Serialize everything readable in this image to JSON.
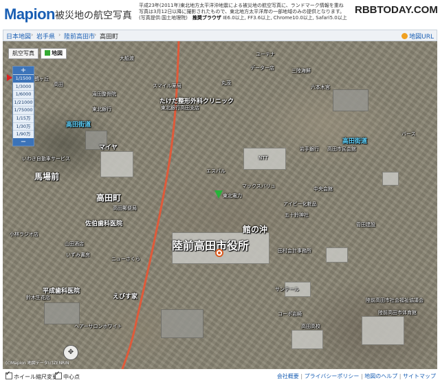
{
  "header": {
    "logo": "Mapion",
    "subtitle": "被災地の航空写真",
    "notice_line1": "平成23年(2011年)東北地方太平洋沖地震による被災地の航空写真に、ランドマーク情報を重ね",
    "notice_line2": "写真は3月12日以降に撮影されたもので、東北地方太平洋岸の一部地域のみの提供となります。",
    "notice_line3": "(写真提供:国土地理院)",
    "browser_label": "推奨ブラウザ",
    "browser_list": "IE6.0以上, FF3.6以上, Chrome10.0以上, Safari5.0以上",
    "watermark": "RBBTODAY.COM"
  },
  "breadcrumb": {
    "items": [
      "日本地図",
      "岩手県",
      "陸前高田市",
      "高田町"
    ],
    "map_url_link": "地図URL"
  },
  "map_controls": {
    "type_buttons": [
      "航空写真",
      "地図"
    ],
    "zoom_in": "+",
    "zoom_out": "−",
    "zoom_levels": [
      "1/1500",
      "1/3000",
      "1/6000",
      "1/21000",
      "1/75000",
      "1/15万",
      "1/30万",
      "1/90万"
    ],
    "selected_zoom": "1/1500"
  },
  "map_labels": {
    "city_hall": "陸前高田市役所",
    "takata_town": "高田町",
    "babamae": "馬場前",
    "tachinooki": "館の沖",
    "takada_street_w": "高田街道",
    "takada_street_e": "高田街道",
    "sasaki_dental": "佐伯歯科医院",
    "heisei_dental": "平成歯科医院",
    "takeda_clinic": "たけだ整形外科クリニック",
    "mayaya": "マイヤ",
    "ebisuya": "えびす家",
    "ntt": "NTT",
    "iwate_bank": "岩手銀行",
    "sanriku_kaisen": "三陸海鮮",
    "rokuhara": "六本木宮",
    "chuo_kaikan": "中央会館",
    "tohoku_bank": "東北銀行",
    "komeri": "コーポ岩崎",
    "takata_hs": "高田高校",
    "misc1": "大船渡",
    "misc2": "東北電力",
    "misc3": "陸前高田市社会福祉協議会",
    "misc4": "ヘアーサロンホワイト",
    "misc5": "小林ラジオ店",
    "misc6": "鈴木生花店",
    "misc7": "いわき自動車サービス",
    "misc8": "高田郵便局",
    "misc9": "エスパル",
    "misc10": "高田市民会館",
    "misc11": "スマイル薬局",
    "misc12": "東北銀行高田支店",
    "misc13": "データー店",
    "misc14": "ユーテナ",
    "misc15": "滝田整骨院",
    "misc16": "五十鈴神社",
    "misc17": "田村会計事務所",
    "misc18": "菅田建設",
    "misc19": "山田酒店",
    "misc20": "丸茂",
    "misc21": "バース",
    "misc22": "高田",
    "misc23": "鶴ヶ丘",
    "misc24": "マックスバリュ",
    "misc25": "アイビー化粧品",
    "misc26": "ニューさくら",
    "misc27": "いずみ書房",
    "misc28": "サンテール",
    "misc29": "陸前高田市体育館",
    "copyright": "(c)Mapion 地図データ(c)ZENRIN"
  },
  "footer": {
    "wheel_zoom": "ホイール縮尺変更",
    "center_mark": "中心点",
    "links": [
      "会社概要",
      "プライバシーポリシー",
      "地図のヘルプ",
      "サイトマップ"
    ]
  }
}
